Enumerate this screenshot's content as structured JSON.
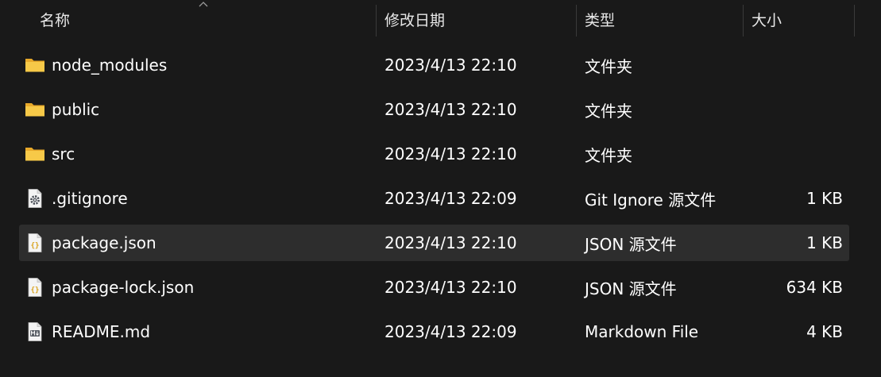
{
  "columns": {
    "name": "名称",
    "date": "修改日期",
    "type": "类型",
    "size": "大小"
  },
  "files": [
    {
      "name": "node_modules",
      "date": "2023/4/13 22:10",
      "type": "文件夹",
      "size": "",
      "icon": "folder-icon",
      "selected": false
    },
    {
      "name": "public",
      "date": "2023/4/13 22:10",
      "type": "文件夹",
      "size": "",
      "icon": "folder-icon",
      "selected": false
    },
    {
      "name": "src",
      "date": "2023/4/13 22:10",
      "type": "文件夹",
      "size": "",
      "icon": "folder-icon",
      "selected": false
    },
    {
      "name": ".gitignore",
      "date": "2023/4/13 22:09",
      "type": "Git Ignore 源文件",
      "size": "1 KB",
      "icon": "gear-file-icon",
      "selected": false
    },
    {
      "name": "package.json",
      "date": "2023/4/13 22:10",
      "type": "JSON 源文件",
      "size": "1 KB",
      "icon": "json-file-icon",
      "selected": true
    },
    {
      "name": "package-lock.json",
      "date": "2023/4/13 22:10",
      "type": "JSON 源文件",
      "size": "634 KB",
      "icon": "json-file-icon",
      "selected": false
    },
    {
      "name": "README.md",
      "date": "2023/4/13 22:09",
      "type": "Markdown File",
      "size": "4 KB",
      "icon": "markdown-file-icon",
      "selected": false
    }
  ],
  "colors": {
    "background": "#191919",
    "selected_row": "#2d2d2d",
    "folder": "#f7c948",
    "text": "#ffffff"
  }
}
